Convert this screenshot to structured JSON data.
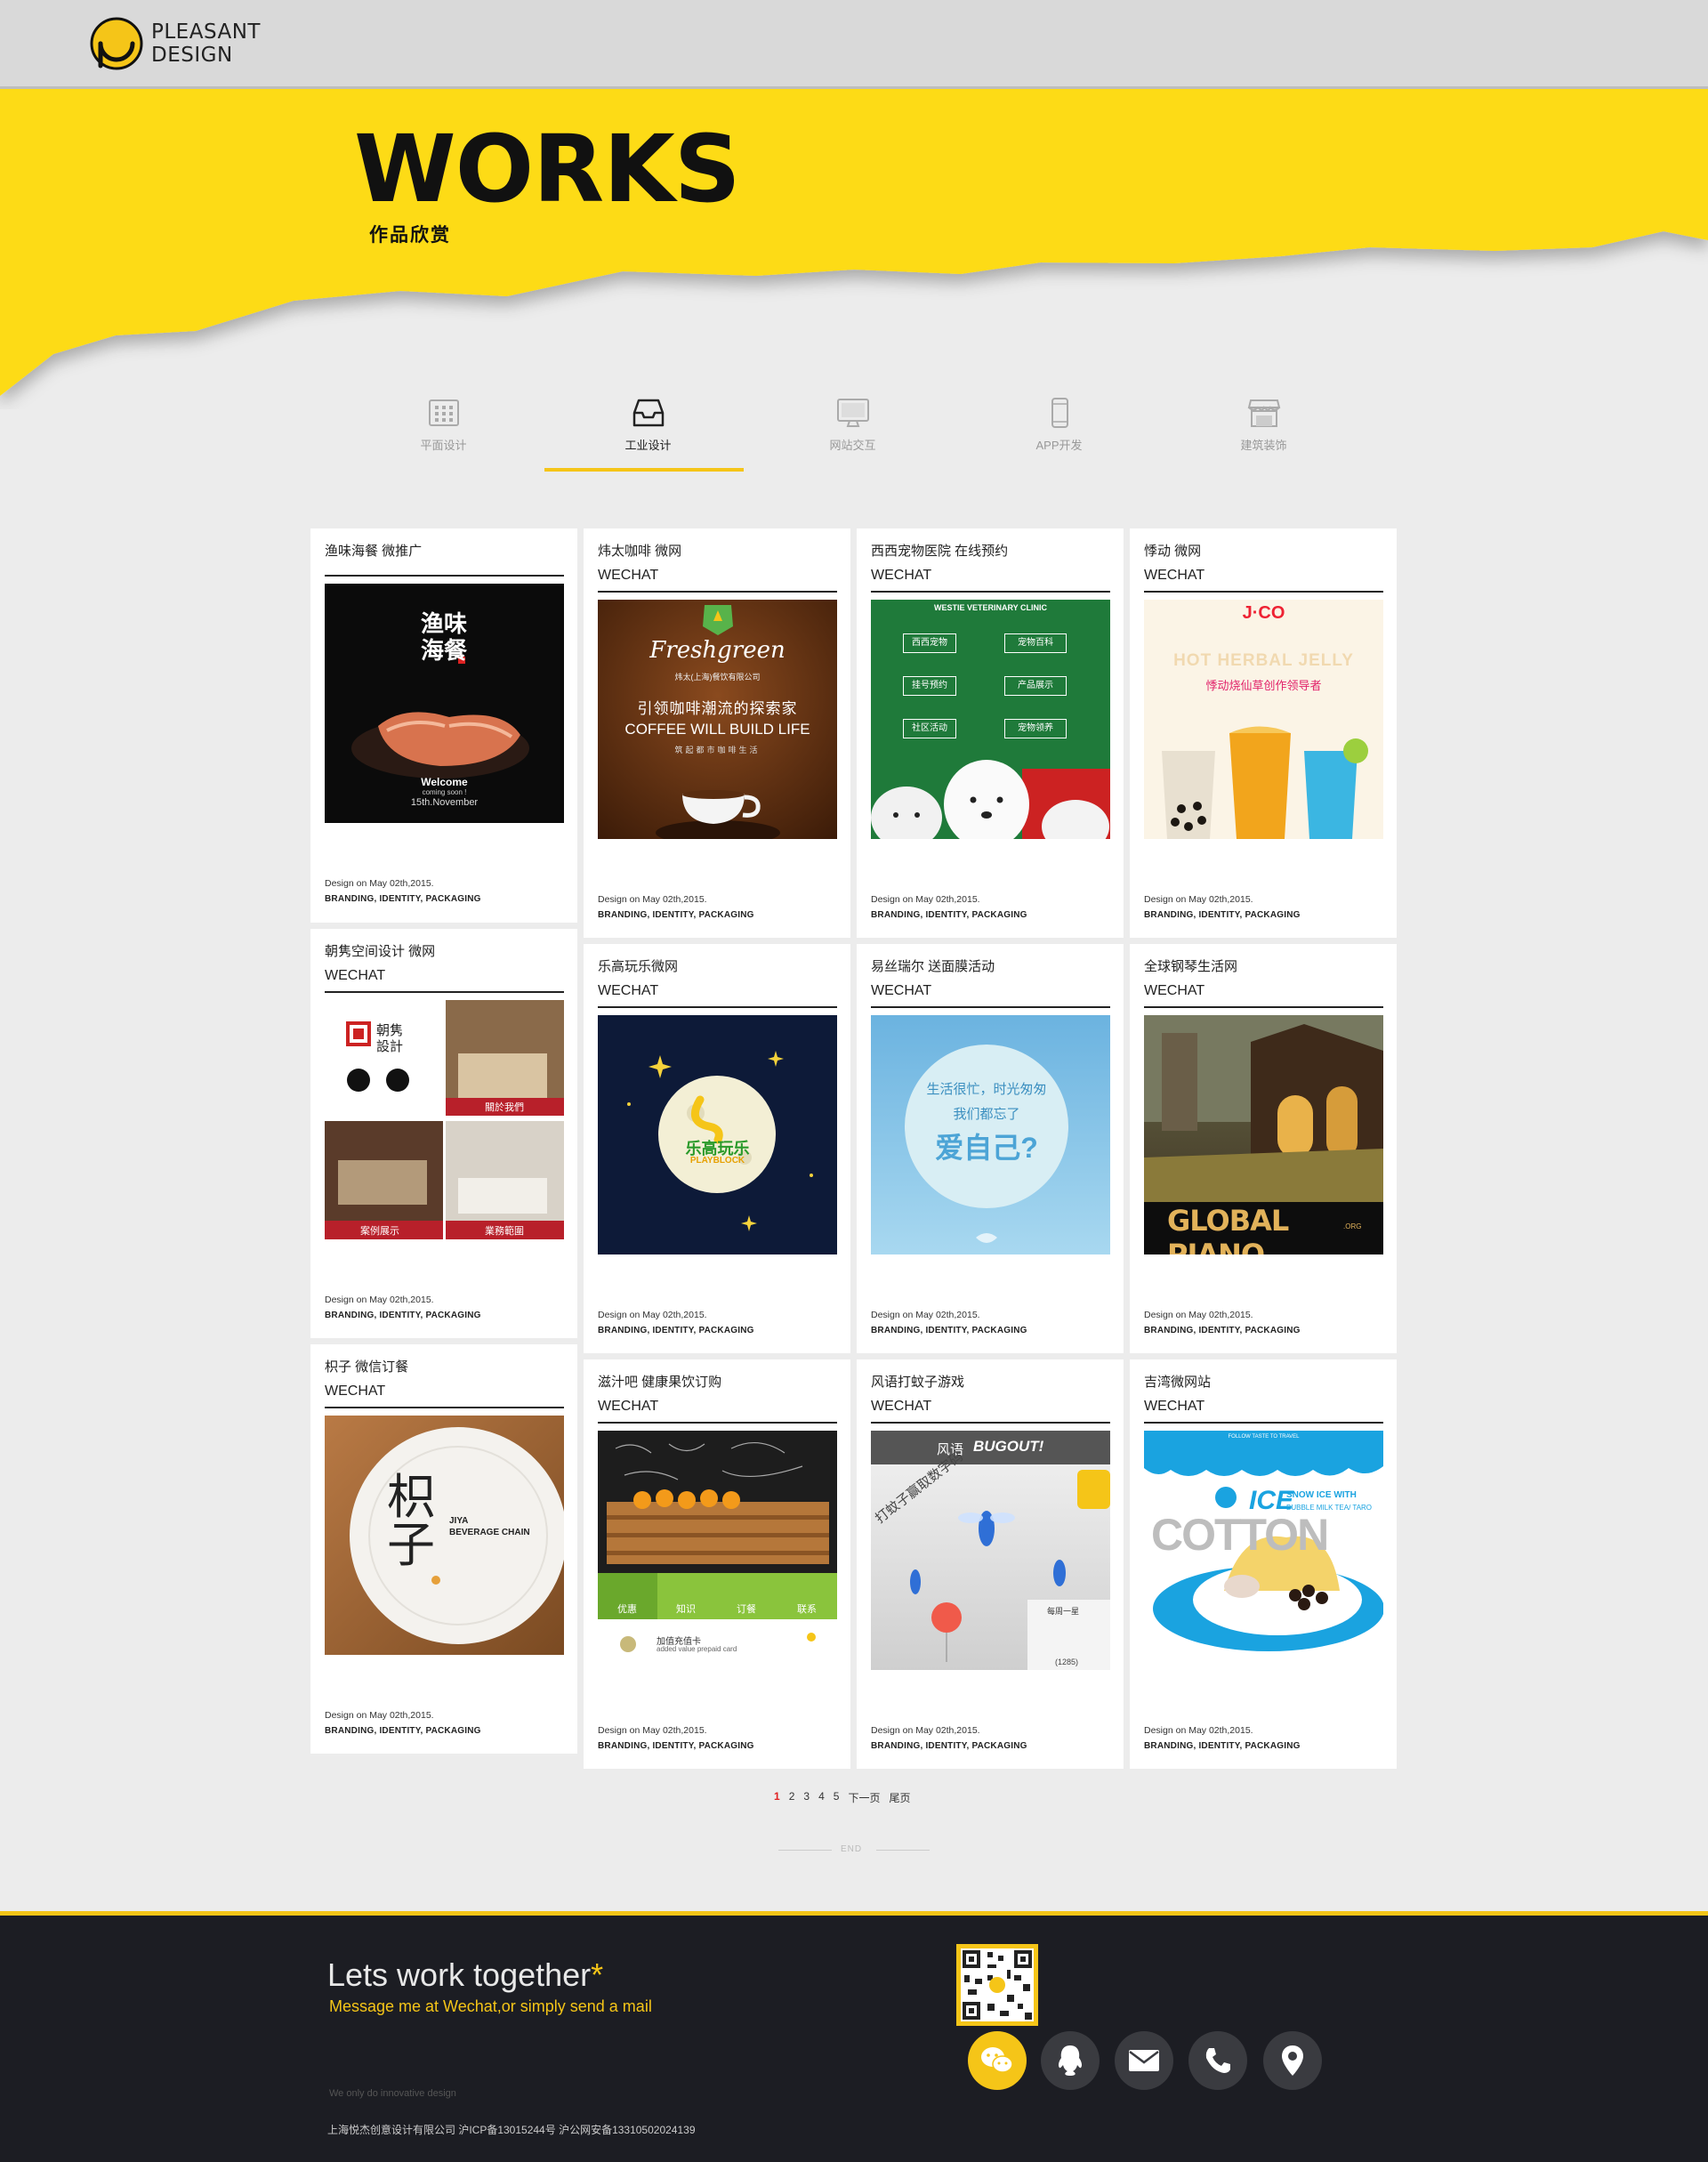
{
  "brand": {
    "line1": "PLEASANT",
    "line2": "DESIGN",
    "accent": "#f5c518"
  },
  "banner": {
    "title": "WORKS",
    "subtitle": "作品欣赏"
  },
  "tabs": [
    {
      "label": "平面设计",
      "icon": "grid-icon"
    },
    {
      "label": "工业设计",
      "icon": "inbox-tray-icon",
      "active": true
    },
    {
      "label": "网站交互",
      "icon": "monitor-icon"
    },
    {
      "label": "APP开发",
      "icon": "phone-icon"
    },
    {
      "label": "建筑装饰",
      "icon": "storefront-icon"
    }
  ],
  "cards": [
    {
      "title": "渔味海餐 微推广",
      "tag": "",
      "date": "Design on May 02th,2015.",
      "meta": "BRANDING, IDENTITY, PACKAGING",
      "img": {
        "kind": "dark",
        "text1": "渔味海餐",
        "text2": "Welcome",
        "text3": "coming soon !",
        "text4": "15th.November"
      }
    },
    {
      "title": "炜太咖啡 微网",
      "tag": "WECHAT",
      "date": "Design on May 02th,2015.",
      "meta": "BRANDING, IDENTITY, PACKAGING",
      "img": {
        "kind": "coffee",
        "text1": "Freshgreen",
        "text2": "炜太(上海)餐饮有限公司",
        "text3": "引领咖啡潮流的探索家",
        "text4": "COFFEE WILL BUILD LIFE",
        "text5": "筑起都市咖啡生活"
      }
    },
    {
      "title": "西西宠物医院 在线预约",
      "tag": "WECHAT",
      "date": "Design on May 02th,2015.",
      "meta": "BRANDING, IDENTITY, PACKAGING",
      "img": {
        "kind": "vet",
        "text1": "WESTIE VETERINARY CLINIC",
        "btns": [
          "西西宠物",
          "宠物百科",
          "挂号预约",
          "产品展示",
          "社区活动",
          "宠物领养"
        ]
      }
    },
    {
      "title": "悸动 微网",
      "tag": "WECHAT",
      "date": "Design on May 02th,2015.",
      "meta": "BRANDING, IDENTITY, PACKAGING",
      "img": {
        "kind": "jco",
        "text1": "J·CO",
        "text2": "HOT HERBAL JELLY",
        "text3": "悸动烧仙草创作领导者"
      }
    },
    {
      "title": "朝隽空间设计 微网",
      "tag": "WECHAT",
      "date": "Design on May 02th,2015.",
      "meta": "BRANDING, IDENTITY, PACKAGING",
      "img": {
        "kind": "interior",
        "text1": "朝隽",
        "text2": "設計",
        "text3": "關於我們",
        "text4": "案例展示",
        "text5": "業務範圍"
      }
    },
    {
      "title": "乐高玩乐微网",
      "tag": "WECHAT",
      "date": "Design on May 02th,2015.",
      "meta": "BRANDING, IDENTITY, PACKAGING",
      "img": {
        "kind": "moon",
        "text1": "乐高玩乐",
        "text2": "PLAYBLOCK"
      }
    },
    {
      "title": "易丝瑞尔 送面膜活动",
      "tag": "WECHAT",
      "date": "Design on May 02th,2015.",
      "meta": "BRANDING, IDENTITY, PACKAGING",
      "img": {
        "kind": "sky",
        "text1": "生活很忙，时光匆匆",
        "text2": "我们都忘了",
        "text3": "爱自己?"
      }
    },
    {
      "title": "全球钢琴生活网",
      "tag": "WECHAT",
      "date": "Design on May 02th,2015.",
      "meta": "BRANDING, IDENTITY, PACKAGING",
      "img": {
        "kind": "piano",
        "text1": "GLOBAL PIANO",
        "text2": ".ORG"
      }
    },
    {
      "title": "枳子 微信订餐",
      "tag": "WECHAT",
      "date": "Design on May 02th,2015.",
      "meta": "BRANDING, IDENTITY, PACKAGING",
      "img": {
        "kind": "plate",
        "text1": "枳子",
        "text2": "JIYA",
        "text3": "BEVERAGE CHAIN"
      }
    },
    {
      "title": "滋汁吧 健康果饮订购",
      "tag": "WECHAT",
      "date": "Design on May 02th,2015.",
      "meta": "BRANDING, IDENTITY, PACKAGING",
      "img": {
        "kind": "juice",
        "tabs": [
          "优惠",
          "知识",
          "订餐",
          "联系"
        ],
        "text1": "加值充值卡",
        "text2": "added value prepaid card"
      }
    },
    {
      "title": "风语打蚊子游戏",
      "tag": "WECHAT",
      "date": "Design on May 02th,2015.",
      "meta": "BRANDING, IDENTITY, PACKAGING",
      "img": {
        "kind": "bugout",
        "text1": "风语",
        "text2": "BUGOUT!",
        "text3": "打蚊子赢取数字码",
        "text4": "每周一星",
        "text5": "(1285)"
      }
    },
    {
      "title": "吉湾微网站",
      "tag": "WECHAT",
      "date": "Design on May 02th,2015.",
      "meta": "BRANDING, IDENTITY, PACKAGING",
      "img": {
        "kind": "ice",
        "text1": "FOLLOW TASTE TO TRAVEL",
        "text2": "ICE",
        "text3": "SNOW ICE WITH",
        "text4": "BUBBLE MILK TEA/ TARO",
        "text5": "COTTON"
      }
    }
  ],
  "pager": {
    "pages": [
      "1",
      "2",
      "3",
      "4",
      "5"
    ],
    "next": "下一页",
    "last": "尾页",
    "current": "1"
  },
  "end_label": "END",
  "footer": {
    "title": "Lets work together",
    "star": "*",
    "subtitle": "Message me at Wechat,or simply send a mail",
    "small": "We only do innovative design",
    "copyright": "上海悦杰创意设计有限公司  沪ICP备13015244号  沪公网安备13310502024139",
    "social": [
      "wechat-icon",
      "qq-icon",
      "mail-icon",
      "phone-icon",
      "location-icon"
    ]
  }
}
